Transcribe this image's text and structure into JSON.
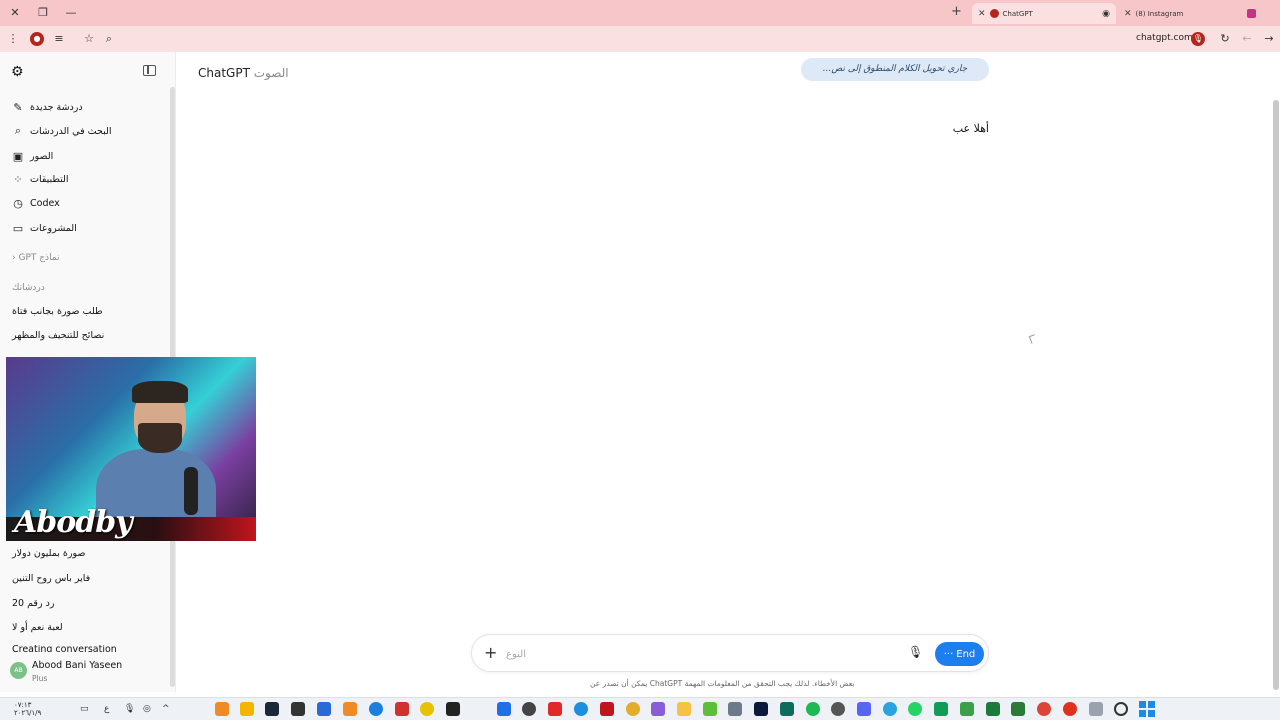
{
  "browser": {
    "tabs": [
      {
        "title": "ChatGPT",
        "active": true,
        "favicon_color": "#b3261e"
      },
      {
        "title": "(8) Instagram",
        "active": false,
        "favicon_color": "#c13584"
      }
    ],
    "url": "chatgpt.com"
  },
  "sidebar": {
    "nav": [
      {
        "label": "دردشة جديدة",
        "icon": "pencil-square-icon"
      },
      {
        "label": "البحث في الدردشات",
        "icon": "search-icon"
      },
      {
        "label": "الصور",
        "icon": "images-icon"
      },
      {
        "label": "التطبيقات",
        "icon": "apps-grid-icon"
      },
      {
        "label": "Codex",
        "icon": "codex-icon"
      },
      {
        "label": "المشروعات",
        "icon": "folder-icon"
      }
    ],
    "gpts_label": "نماذج GPT",
    "chats_label": "دردشاتك",
    "chats_top": [
      "طلب صورة بجانب فتاة",
      "نصائح للتنحيف والمظهر"
    ],
    "chats_bottom": [
      "صورة بمليون دولار",
      "فاير باس روح التنين",
      "رد رقم 20",
      "لعبة نعم أو لا",
      "Creating conversation"
    ],
    "user": {
      "initials": "AB",
      "name": "Abood Bani Yaseen",
      "plan": "Plus"
    }
  },
  "webcam": {
    "brand": "Abodby"
  },
  "main": {
    "title": "ChatGPT",
    "subtitle": "الصوت",
    "toast": "جاري تحويل الكلام المنطوق إلى نص...",
    "message": "أهلا عب"
  },
  "composer": {
    "placeholder": "النوع",
    "end_label": "End"
  },
  "disclaimer": "بعض الأخطاء. لذلك يجب التحقق من المعلومات المهمة ChatGPT يمكن أن تصدر عن",
  "taskbar": {
    "time": "٠٧:١٣",
    "date": "٢٠٢٦/١/٩",
    "lang": "ع"
  }
}
